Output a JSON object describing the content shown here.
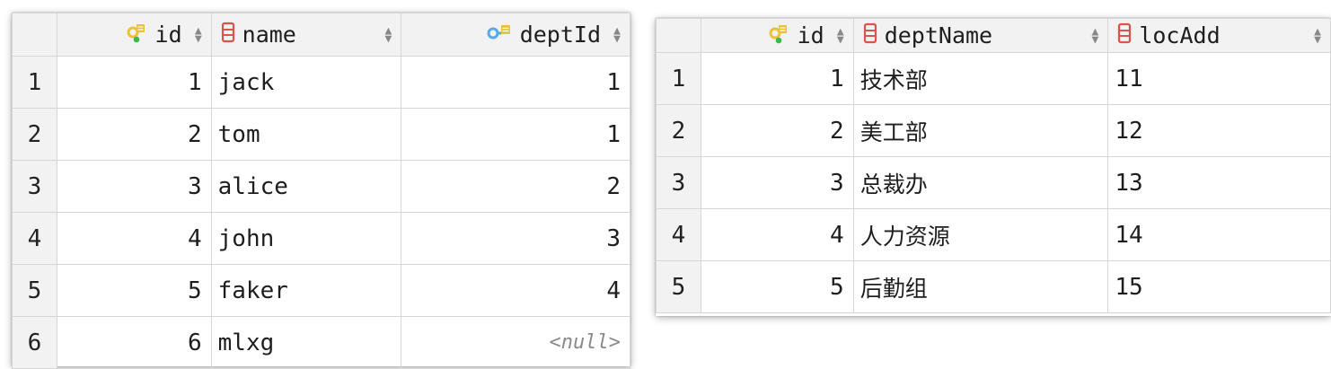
{
  "employee_table": {
    "columns": [
      {
        "label": "id",
        "icon": "primary-key-icon",
        "align": "right"
      },
      {
        "label": "name",
        "icon": "column-icon",
        "align": "left"
      },
      {
        "label": "deptId",
        "icon": "foreign-key-icon",
        "align": "right"
      }
    ],
    "rows": [
      {
        "n": "1",
        "id": "1",
        "name": "jack",
        "deptId": "1"
      },
      {
        "n": "2",
        "id": "2",
        "name": "tom",
        "deptId": "1"
      },
      {
        "n": "3",
        "id": "3",
        "name": "alice",
        "deptId": "2"
      },
      {
        "n": "4",
        "id": "4",
        "name": "john",
        "deptId": "3"
      },
      {
        "n": "5",
        "id": "5",
        "name": "faker",
        "deptId": "4"
      },
      {
        "n": "6",
        "id": "6",
        "name": "mlxg",
        "deptId": "<null>"
      }
    ]
  },
  "dept_table": {
    "columns": [
      {
        "label": "id",
        "icon": "primary-key-icon",
        "align": "right"
      },
      {
        "label": "deptName",
        "icon": "column-icon",
        "align": "left"
      },
      {
        "label": "locAdd",
        "icon": "column-icon",
        "align": "left"
      }
    ],
    "rows": [
      {
        "n": "1",
        "id": "1",
        "deptName": "技术部",
        "locAdd": "11"
      },
      {
        "n": "2",
        "id": "2",
        "deptName": "美工部",
        "locAdd": "12"
      },
      {
        "n": "3",
        "id": "3",
        "deptName": "总裁办",
        "locAdd": "13"
      },
      {
        "n": "4",
        "id": "4",
        "deptName": "人力资源",
        "locAdd": "14"
      },
      {
        "n": "5",
        "id": "5",
        "deptName": "后勤组",
        "locAdd": "15"
      }
    ]
  },
  "sort_glyphs": {
    "up": "▲",
    "down": "▼"
  },
  "colors": {
    "header_bg": "#f2f2f2",
    "grid_line": "#d6d6d6",
    "key_yellow": "#e8c23a",
    "key_blue": "#5aa9e6",
    "column_red": "#d9534f",
    "null_gray": "#8a8a8a"
  }
}
